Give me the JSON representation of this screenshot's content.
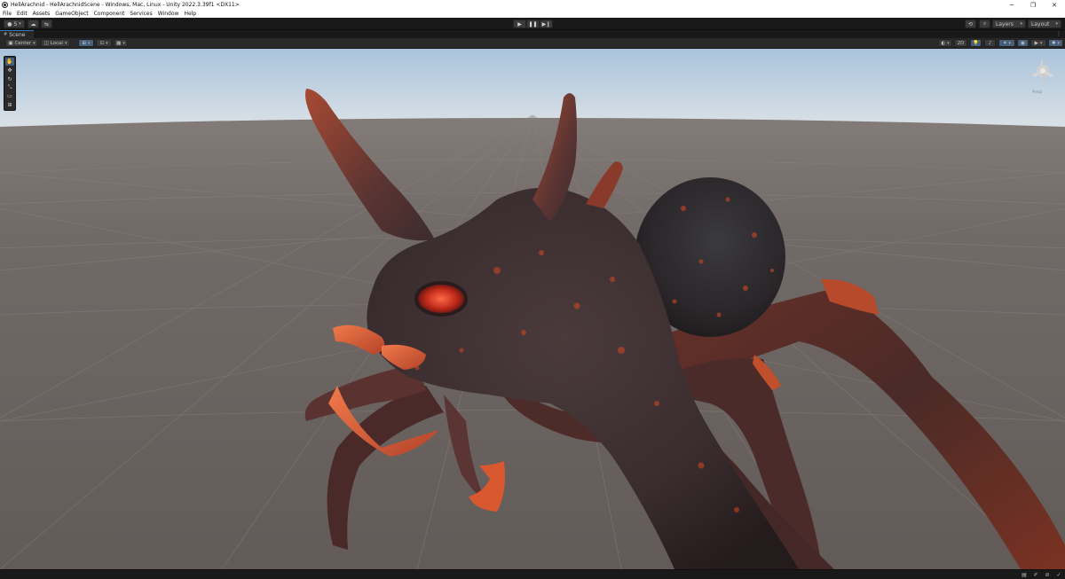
{
  "window": {
    "title": "HellArachnid - HellArachnidScene - Windows, Mac, Linux - Unity 2022.3.39f1 <DX11>",
    "controls": {
      "minimize": "─",
      "restore": "❐",
      "close": "✕"
    }
  },
  "menu": [
    "File",
    "Edit",
    "Assets",
    "GameObject",
    "Component",
    "Services",
    "Window",
    "Help"
  ],
  "toolbar": {
    "account_label": "S",
    "play": "▶",
    "pause": "❚❚",
    "step": "▶❙",
    "layers_label": "Layers",
    "layout_label": "Layout"
  },
  "scene_tab": {
    "label": "Scene",
    "icon": "grid-icon",
    "menu": "⋮"
  },
  "scene_toolbar": {
    "pivot_label": "Center",
    "space_label": "Local",
    "mode_2d_label": "2D"
  },
  "tools": [
    {
      "name": "hand-tool",
      "glyph": "✋",
      "active": true
    },
    {
      "name": "move-tool",
      "glyph": "✥",
      "active": false
    },
    {
      "name": "rotate-tool",
      "glyph": "↻",
      "active": false
    },
    {
      "name": "scale-tool",
      "glyph": "⤡",
      "active": false
    },
    {
      "name": "rect-tool",
      "glyph": "▭",
      "active": false
    },
    {
      "name": "transform-tool",
      "glyph": "⊞",
      "active": false
    }
  ],
  "gizmo": {
    "label": "Persp"
  },
  "colors": {
    "sky_top": "#a9c3dc",
    "sky_horizon": "#dde3e6",
    "ground": "#6b6563",
    "creature_dark": "#3b2d2e",
    "creature_lava": "#d04a22",
    "accent": "#3a79bb"
  }
}
